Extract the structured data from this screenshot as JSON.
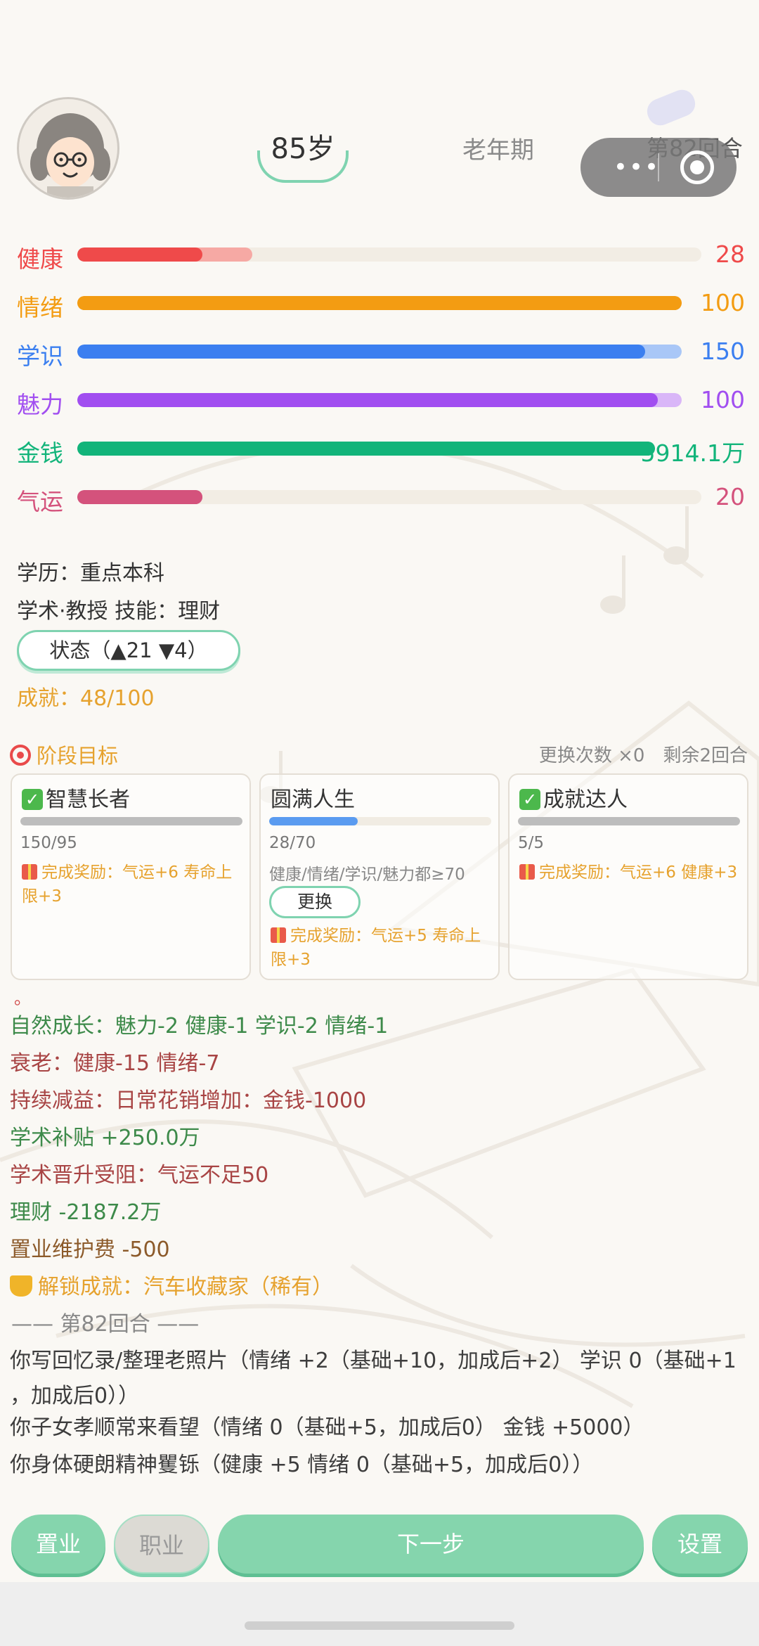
{
  "header": {
    "age": "85岁",
    "stage": "老年期",
    "round": "第82回合"
  },
  "capsule": {
    "more_symbol": "•••"
  },
  "stats": [
    {
      "label": "健康",
      "value": "28",
      "fill": 0.2,
      "fill2": 0.28,
      "color": "#ef4a4a",
      "color2": "#f6a9a4"
    },
    {
      "label": "情绪",
      "value": "100",
      "fill": 1.0,
      "fill2": 1.0,
      "color": "#f39c12",
      "color2": "#f39c12"
    },
    {
      "label": "学识",
      "value": "150",
      "fill": 0.94,
      "fill2": 1.0,
      "color": "#3b7ff0",
      "color2": "#a9c7f7"
    },
    {
      "label": "魅力",
      "value": "100",
      "fill": 0.96,
      "fill2": 1.0,
      "color": "#a14ef0",
      "color2": "#d9b6f8"
    },
    {
      "label": "金钱",
      "value": "5914.1万",
      "fill": 1.0,
      "fill2": 1.0,
      "color": "#12b47a",
      "color2": "#12b47a"
    },
    {
      "label": "气运",
      "value": "20",
      "fill": 0.2,
      "fill2": 0.2,
      "color": "#d4527c",
      "color2": "#d4527c"
    }
  ],
  "profile": {
    "education": "学历：重点本科",
    "career_skill": "学术·教授 技能：理财",
    "status_button": "状态（▲21 ▼4）",
    "achievement": "成就：48/100"
  },
  "goals": {
    "title": "阶段目标",
    "meta": "更换次数 ×0　剩余2回合",
    "cards": [
      {
        "title": "智慧长者",
        "done": true,
        "progress": "150/95",
        "fill": 1.0,
        "bar_color": "#bdbdbd",
        "desc": "",
        "reward": "完成奖励：气运+6 寿命上限+3"
      },
      {
        "title": "圆满人生",
        "done": false,
        "progress": "28/70",
        "fill": 0.4,
        "bar_color": "#5a9bf0",
        "desc": "健康/情绪/学识/魅力都≥70",
        "swap_label": "更换",
        "reward": "完成奖励：气运+5 寿命上限+3"
      },
      {
        "title": "成就达人",
        "done": true,
        "progress": "5/5",
        "fill": 1.0,
        "bar_color": "#bdbdbd",
        "desc": "",
        "reward": "完成奖励：气运+6 健康+3"
      }
    ]
  },
  "log": {
    "stray_dot": "。",
    "lines": [
      "自然成长：魅力-2 健康-1 学识-2 情绪-1",
      "衰老：健康-15 情绪-7",
      "持续减益：日常花销增加：金钱-1000",
      "学术补贴 +250.0万",
      "学术晋升受阻：气运不足50",
      "理财 -2187.2万",
      "置业维护费 -500",
      "解锁成就：汽车收藏家（稀有）",
      "—— 第82回合 ——",
      "你写回忆录/整理老照片（情绪 +2（基础+10，加成后+2） 学识 0（基础+1",
      "，加成后0））",
      "你子女孝顺常来看望（情绪 0（基础+5，加成后0） 金钱 +5000）",
      "你身体硬朗精神矍铄（健康 +5 情绪 0（基础+5，加成后0））"
    ]
  },
  "actions": {
    "property": "置业",
    "career": "职业",
    "next": "下一步",
    "settings": "设置"
  }
}
